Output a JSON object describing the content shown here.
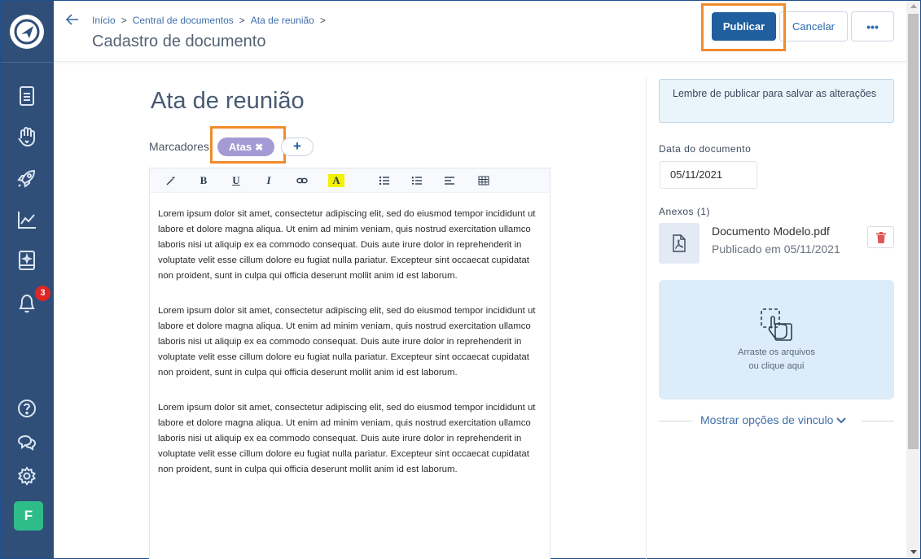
{
  "sidebar": {
    "notifications_count": "3",
    "avatar_initial": "F",
    "icons": [
      "logo-icon",
      "documents-icon",
      "hand-heart-icon",
      "rocket-icon",
      "chart-icon",
      "book-sparkle-icon",
      "bell-icon",
      "help-icon",
      "chat-icon",
      "gear-icon"
    ]
  },
  "header": {
    "breadcrumb": [
      "Início",
      "Central de documentos",
      "Ata de reunião"
    ],
    "breadcrumb_separator": ">",
    "title": "Cadastro de documento",
    "publish_label": "Publicar",
    "cancel_label": "Cancelar",
    "more_label": "•••"
  },
  "document": {
    "title": "Ata de reunião",
    "tags_label": "Marcadores",
    "tags": [
      {
        "label": "Atas",
        "color": "#a59bd4"
      }
    ],
    "add_tag_label": "+",
    "paragraphs": [
      "Lorem ipsum dolor sit amet, consectetur adipiscing elit, sed do eiusmod tempor incididunt ut labore et dolore magna aliqua. Ut enim ad minim veniam, quis nostrud exercitation ullamco laboris nisi ut aliquip ex ea commodo consequat. Duis aute irure dolor in reprehenderit in voluptate velit esse cillum dolore eu fugiat nulla pariatur. Excepteur sint occaecat cupidatat non proident, sunt in culpa qui officia deserunt mollit anim id est laborum.",
      "Lorem ipsum dolor sit amet, consectetur adipiscing elit, sed do eiusmod tempor incididunt ut labore et dolore magna aliqua. Ut enim ad minim veniam, quis nostrud exercitation ullamco laboris nisi ut aliquip ex ea commodo consequat. Duis aute irure dolor in reprehenderit in voluptate velit esse cillum dolore eu fugiat nulla pariatur. Excepteur sint occaecat cupidatat non proident, sunt in culpa qui officia deserunt mollit anim id est laborum.",
      "Lorem ipsum dolor sit amet, consectetur adipiscing elit, sed do eiusmod tempor incididunt ut labore et dolore magna aliqua. Ut enim ad minim veniam, quis nostrud exercitation ullamco laboris nisi ut aliquip ex ea commodo consequat. Duis aute irure dolor in reprehenderit in voluptate velit esse cillum dolore eu fugiat nulla pariatur. Excepteur sint occaecat cupidatat non proident, sunt in culpa qui officia deserunt mollit anim id est laborum."
    ],
    "toolbar": {
      "bold": "B",
      "underline": "U",
      "italic": "I",
      "highlight": "A",
      "icons": [
        "magic-wand-icon",
        "bold-icon",
        "underline-icon",
        "italic-icon",
        "link-icon",
        "highlight-icon",
        "bullet-list-icon",
        "numbered-list-icon",
        "align-left-icon",
        "table-icon"
      ]
    }
  },
  "panel": {
    "info_message": "Lembre de publicar para salvar as alterações",
    "date_label": "Data do documento",
    "date_value": "05/11/2021",
    "attachments_label": "Anexos (1)",
    "attachments": [
      {
        "name": "Documento Modelo.pdf",
        "status": "Publicado em 05/11/2021",
        "icon": "pdf-file-icon"
      }
    ],
    "dropzone_line1": "Arraste os arquivos",
    "dropzone_line2": "ou clique aqui",
    "link_options_label": "Mostrar opções de vinculo"
  },
  "colors": {
    "sidebar_bg": "#2f4f79",
    "primary": "#1f5fa0",
    "highlight_outline": "#f28b2a",
    "tag": "#a59bd4",
    "badge": "#e02424",
    "avatar": "#2ebd8a"
  }
}
